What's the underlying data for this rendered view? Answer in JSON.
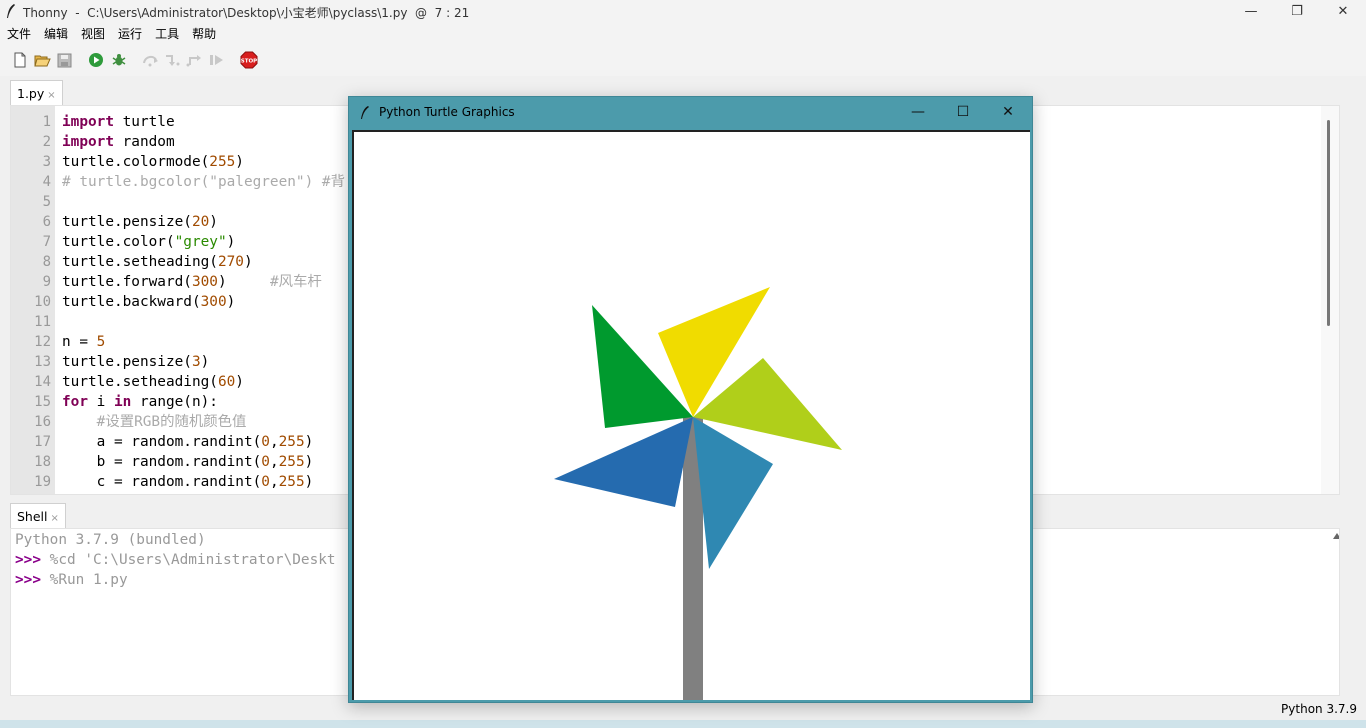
{
  "window": {
    "app_name": "Thonny",
    "title": "Thonny  -  C:\\Users\\Administrator\\Desktop\\小宝老师\\pyclass\\1.py  @  7 : 21",
    "minimize": "—",
    "maximize": "❐",
    "close": "✕"
  },
  "menu": [
    "文件",
    "编辑",
    "视图",
    "运行",
    "工具",
    "帮助"
  ],
  "toolbar": {
    "icons": [
      "new-file-icon",
      "open-file-icon",
      "save-icon",
      "run-icon",
      "debug-icon",
      "step-over-icon",
      "step-into-icon",
      "step-out-icon",
      "resume-icon",
      "stop-icon"
    ],
    "stop_label": "STOP"
  },
  "editor": {
    "tab_label": "1.py",
    "tab_close": "×",
    "line_numbers": [
      "1",
      "2",
      "3",
      "4",
      "5",
      "6",
      "7",
      "8",
      "9",
      "10",
      "11",
      "12",
      "13",
      "14",
      "15",
      "16",
      "17",
      "18",
      "19"
    ]
  },
  "shell": {
    "tab_label": "Shell",
    "tab_close": "×",
    "version_line": "Python 3.7.9 (bundled)",
    "prompt": ">>>",
    "cmd1": " %cd 'C:\\Users\\Administrator\\Deskt",
    "cmd2": " %Run 1.py"
  },
  "status": {
    "interpreter": "Python 3.7.9"
  },
  "turtle_window": {
    "title": "Python Turtle Graphics",
    "minimize": "—",
    "maximize": "☐",
    "close": "✕"
  },
  "colors": {
    "keyword": "#7f0055",
    "number": "#a04b00",
    "string": "#2a8a00",
    "comment": "#aaaaaa",
    "turtle_titlebar": "#4c9bab",
    "stick": "#808080",
    "blade_green": "#009a2e",
    "blade_yellow": "#f0dc00",
    "blade_lime": "#b0cf1a",
    "blade_steel": "#2f88b2",
    "blade_blue": "#256baf"
  }
}
